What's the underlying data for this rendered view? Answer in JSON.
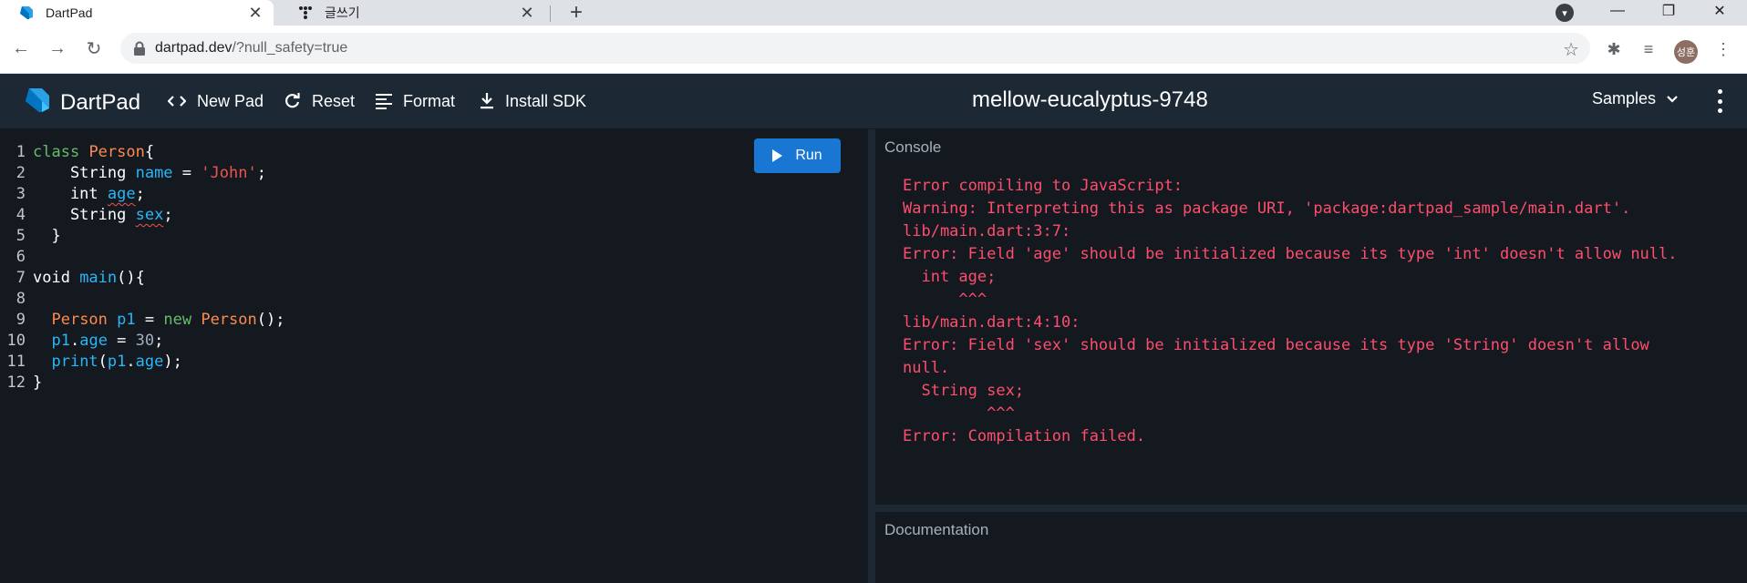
{
  "browser": {
    "tabs": [
      {
        "title": "DartPad",
        "active": true,
        "favicon": "dart-icon"
      },
      {
        "title": "글쓰기",
        "active": false,
        "favicon": "dots-icon"
      }
    ],
    "url_host": "dartpad.dev",
    "url_path": "/?null_safety=true",
    "profile_initials": "성훈"
  },
  "app": {
    "logo_text": "DartPad",
    "buttons": {
      "new_pad": "New Pad",
      "reset": "Reset",
      "format": "Format",
      "install_sdk": "Install SDK"
    },
    "pad_title": "mellow-eucalyptus-9748",
    "samples_label": "Samples",
    "run_label": "Run"
  },
  "editor": {
    "line_numbers": [
      "1",
      "2",
      "3",
      "4",
      "5",
      "6",
      "7",
      "8",
      "9",
      "10",
      "11",
      "12"
    ],
    "lines": [
      "class Person{",
      "    String name = 'John';",
      "    int age;",
      "    String sex;",
      "  }",
      "",
      "void main(){",
      "",
      "  Person p1 = new Person();",
      "  p1.age = 30;",
      "  print(p1.age);",
      "}"
    ]
  },
  "console": {
    "title": "Console",
    "output": "Error compiling to JavaScript:\nWarning: Interpreting this as package URI, 'package:dartpad_sample/main.dart'.\nlib/main.dart:3:7:\nError: Field 'age' should be initialized because its type 'int' doesn't allow null.\n  int age;\n      ^^^\nlib/main.dart:4:10:\nError: Field 'sex' should be initialized because its type 'String' doesn't allow\nnull.\n  String sex;\n         ^^^\nError: Compilation failed."
  },
  "documentation": {
    "title": "Documentation"
  },
  "colors": {
    "header_bg": "#1c2834",
    "editor_bg": "#13191f",
    "run_button": "#1976d2",
    "console_error": "#ff4d6d"
  }
}
